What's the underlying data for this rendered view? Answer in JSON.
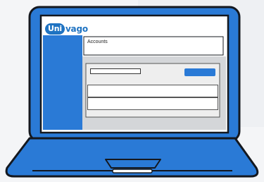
{
  "app": {
    "logo": {
      "badge_text": "Uni",
      "rest_text": "vago",
      "brand_color": "#1f73c2"
    }
  },
  "page": {
    "title": "Accounts"
  },
  "toolbar": {
    "search_value": "",
    "button_label": "",
    "button_color": "#2a7ad6"
  },
  "table": {
    "row_count": 2
  },
  "device": {
    "frame_color": "#2a7ad6",
    "outline_color": "#14181f"
  }
}
